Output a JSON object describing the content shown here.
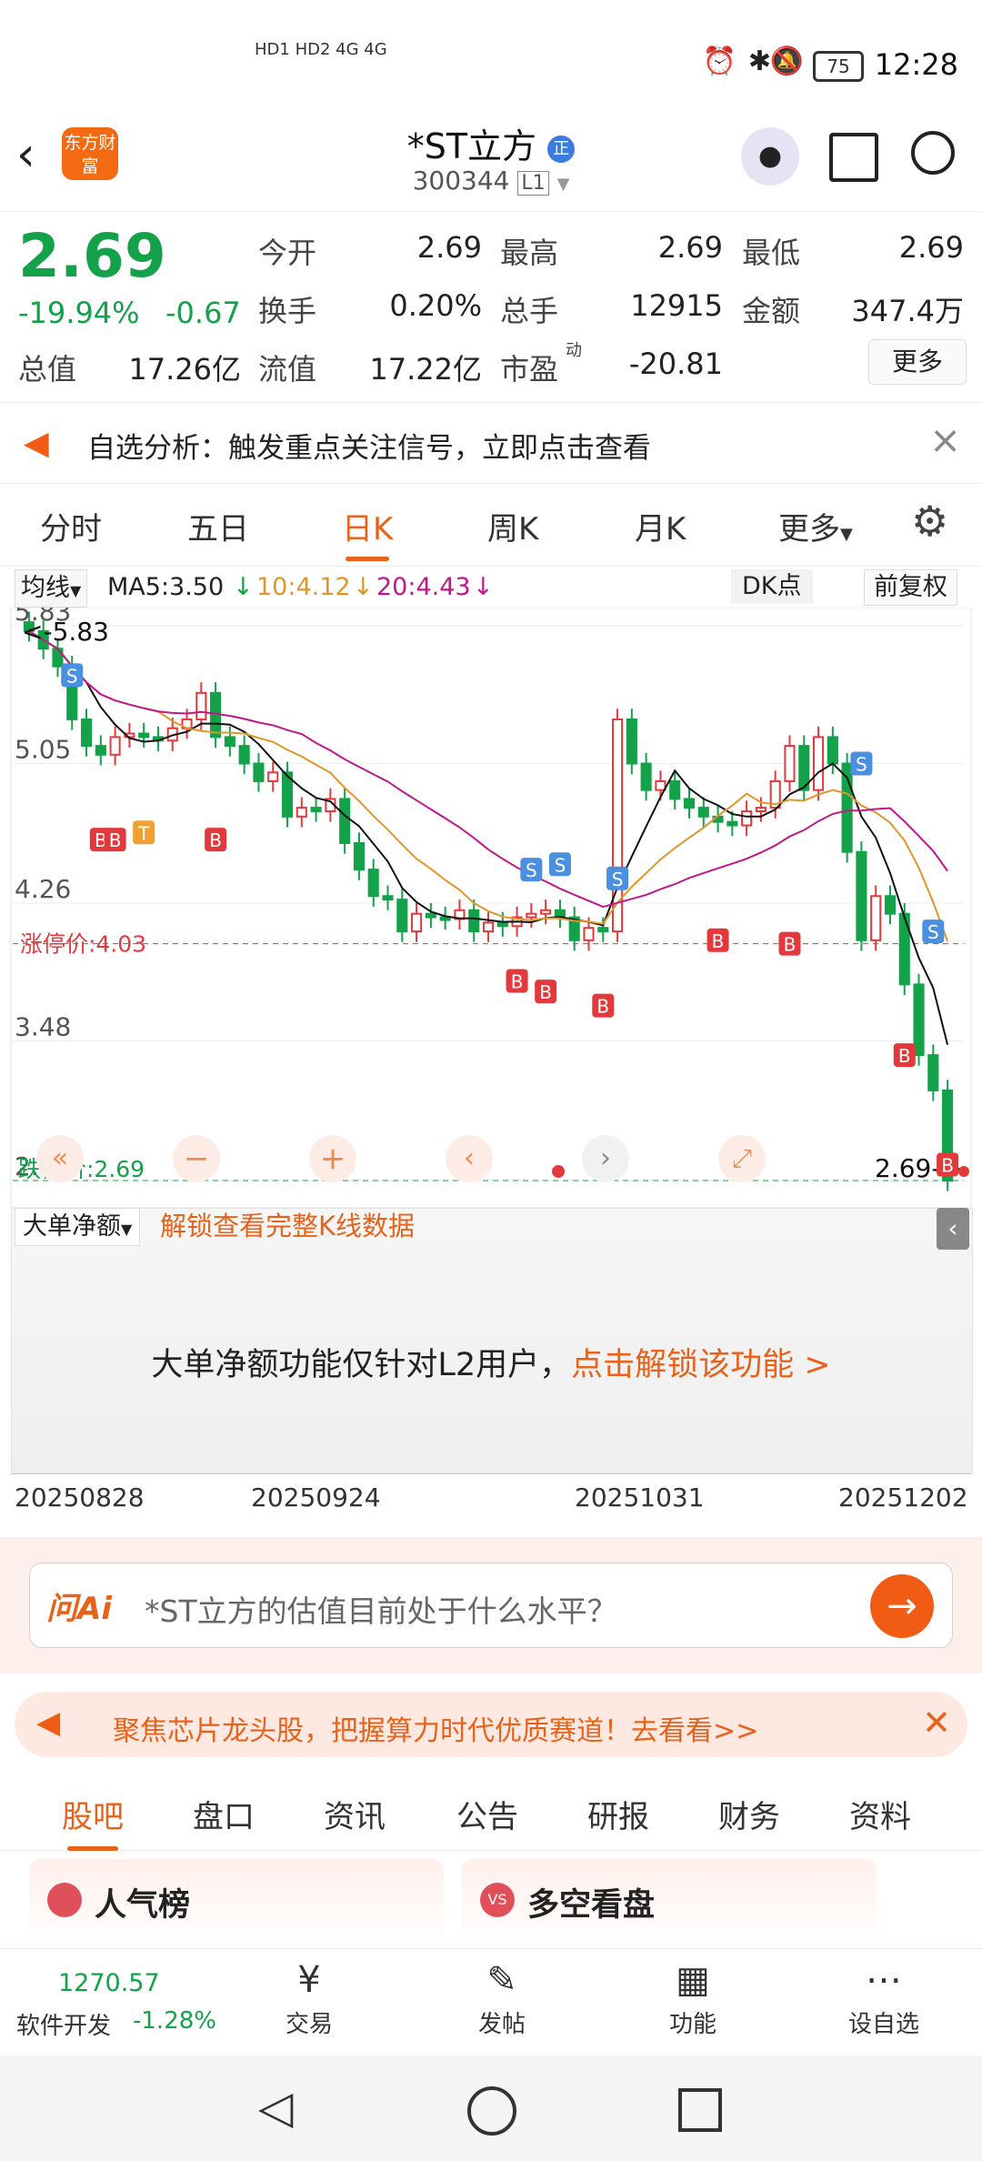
{
  "status_bar": {
    "time": "12:28",
    "battery": "75",
    "signal_left": "HD1 HD2 4G 4G"
  },
  "header": {
    "title": "*ST立方",
    "code": "300344",
    "level": "L1",
    "logo_text": "东方财富",
    "badge": "正"
  },
  "quote": {
    "price": "2.69",
    "change_pct": "-19.94%",
    "change": "-0.67",
    "fields": [
      {
        "label": "今开",
        "value": "2.69"
      },
      {
        "label": "最高",
        "value": "2.69"
      },
      {
        "label": "最低",
        "value": "2.69"
      },
      {
        "label": "换手",
        "value": "0.20%"
      },
      {
        "label": "总手",
        "value": "12915"
      },
      {
        "label": "金额",
        "value": "347.4万"
      },
      {
        "label": "总值",
        "value": "17.26亿"
      },
      {
        "label": "流值",
        "value": "17.22亿"
      },
      {
        "label": "市盈",
        "value": "-20.81"
      }
    ],
    "pe_sup": "动",
    "more": "更多"
  },
  "notice": {
    "text": "自选分析：触发重点关注信号，立即点击查看"
  },
  "tabs": [
    "分时",
    "五日",
    "日K",
    "周K",
    "月K",
    "更多"
  ],
  "chart_bar": {
    "ma_select": "均线",
    "ma5": "MA5:3.50",
    "ma10": "10:4.12",
    "ma20": "20:4.43",
    "dk": "DK点",
    "fq": "前复权"
  },
  "chart_data": {
    "type": "candlestick",
    "y_labels": [
      "5.83",
      "5.05",
      "4.26",
      "3.48",
      "2.69"
    ],
    "limit_up_label": "涨停价:4.03",
    "limit_down_label": "跌停价:2.69",
    "high_marker": "5.83",
    "last_marker": "2.69",
    "ma5": 3.5,
    "ma10": 4.12,
    "ma20": 4.43,
    "x_labels": [
      "20250828",
      "20250924",
      "20251031",
      "20251202"
    ],
    "ylim": [
      2.69,
      5.83
    ]
  },
  "lower": {
    "select": "大单净额",
    "unlock": "解锁查看完整K线数据",
    "msg": "大单净额功能仅针对L2用户，",
    "msg_link": "点击解锁该功能 >"
  },
  "ask": {
    "brand": "问Ai",
    "placeholder": "*ST立方的估值目前处于什么水平？"
  },
  "banner": {
    "text": "聚焦芯片龙头股，把握算力时代优质赛道！去看看>>"
  },
  "bottom_tabs": [
    "股吧",
    "盘口",
    "资讯",
    "公告",
    "研报",
    "财务",
    "资料"
  ],
  "cards": [
    {
      "title": "人气榜"
    },
    {
      "title": "多空看盘"
    }
  ],
  "bottom_bar": {
    "index_value": "1270.57",
    "index_name": "软件开发",
    "index_change": "-1.28%",
    "items": [
      "交易",
      "发帖",
      "功能",
      "设自选"
    ]
  },
  "colors": {
    "accent": "#e8621a",
    "down": "#13a24a",
    "up": "#e4393c"
  }
}
